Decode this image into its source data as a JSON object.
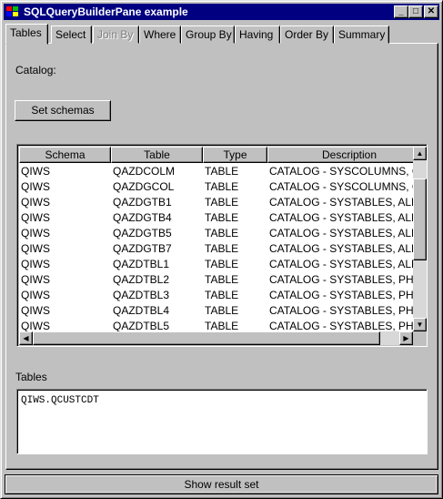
{
  "window": {
    "title": "SQLQueryBuilderPane example",
    "controls": [
      "_",
      "□",
      "✕"
    ]
  },
  "tabs": [
    {
      "label": "Tables",
      "active": true,
      "enabled": true
    },
    {
      "label": "Select",
      "active": false,
      "enabled": true
    },
    {
      "label": "Join By",
      "active": false,
      "enabled": false
    },
    {
      "label": "Where",
      "active": false,
      "enabled": true
    },
    {
      "label": "Group By",
      "active": false,
      "enabled": true
    },
    {
      "label": "Having",
      "active": false,
      "enabled": true
    },
    {
      "label": "Order By",
      "active": false,
      "enabled": true
    },
    {
      "label": "Summary",
      "active": false,
      "enabled": true
    }
  ],
  "catalog": {
    "label": "Catalog:"
  },
  "set_schemas_button": "Set schemas",
  "table": {
    "columns": [
      "Schema",
      "Table",
      "Type",
      "Description"
    ],
    "rows": [
      [
        "QIWS",
        "QAZDCOLM",
        "TABLE",
        "CATALOG - SYSCOLUMNS, CO"
      ],
      [
        "QIWS",
        "QAZDGCOL",
        "TABLE",
        "CATALOG - SYSCOLUMNS, GR"
      ],
      [
        "QIWS",
        "QAZDGTB1",
        "TABLE",
        "CATALOG - SYSTABLES, ALL"
      ],
      [
        "QIWS",
        "QAZDGTB4",
        "TABLE",
        "CATALOG - SYSTABLES, ALL"
      ],
      [
        "QIWS",
        "QAZDGTB5",
        "TABLE",
        "CATALOG - SYSTABLES, ALL"
      ],
      [
        "QIWS",
        "QAZDGTB7",
        "TABLE",
        "CATALOG - SYSTABLES, ALL"
      ],
      [
        "QIWS",
        "QAZDTBL1",
        "TABLE",
        "CATALOG - SYSTABLES, ALL"
      ],
      [
        "QIWS",
        "QAZDTBL2",
        "TABLE",
        "CATALOG - SYSTABLES, PHY"
      ],
      [
        "QIWS",
        "QAZDTBL3",
        "TABLE",
        "CATALOG - SYSTABLES, PHY"
      ],
      [
        "QIWS",
        "QAZDTBL4",
        "TABLE",
        "CATALOG - SYSTABLES, PHY"
      ],
      [
        "QIWS",
        "QAZDTBL5",
        "TABLE",
        "CATALOG - SYSTABLES, PHY"
      ]
    ]
  },
  "tables_section": {
    "label": "Tables",
    "value": "QIWS.QCUSTCDT"
  },
  "show_result_button": "Show result set"
}
